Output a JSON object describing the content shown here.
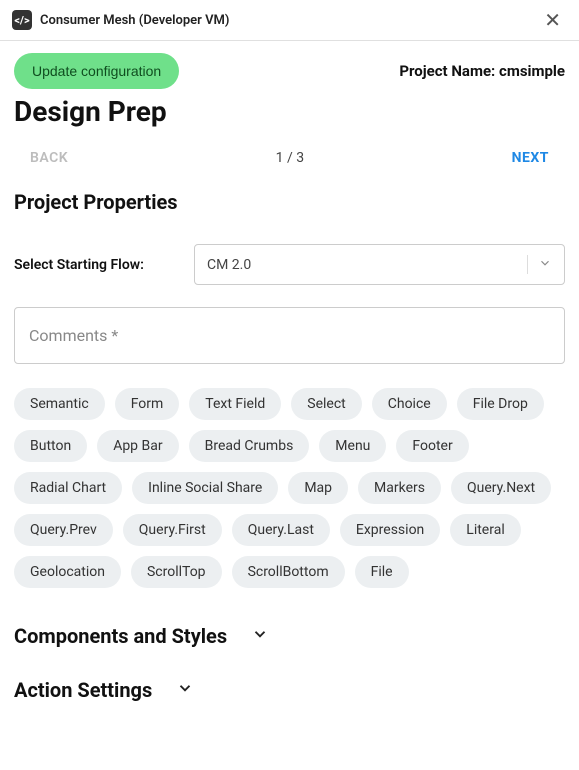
{
  "titlebar": {
    "title": "Consumer Mesh (Developer VM)"
  },
  "header": {
    "update_label": "Update configuration",
    "project_name_prefix": "Project Name: ",
    "project_name": "cmsimple"
  },
  "page_title": "Design Prep",
  "nav": {
    "back": "BACK",
    "counter": "1 / 3",
    "next": "NEXT"
  },
  "sections": {
    "project_properties": "Project Properties",
    "components_styles": "Components and Styles",
    "action_settings": "Action Settings"
  },
  "flow": {
    "label": "Select Starting Flow:",
    "value": "CM 2.0"
  },
  "comments": {
    "placeholder": "Comments *"
  },
  "chips": [
    "Semantic",
    "Form",
    "Text Field",
    "Select",
    "Choice",
    "File Drop",
    "Button",
    "App Bar",
    "Bread Crumbs",
    "Menu",
    "Footer",
    "Radial Chart",
    "Inline Social Share",
    "Map",
    "Markers",
    "Query.Next",
    "Query.Prev",
    "Query.First",
    "Query.Last",
    "Expression",
    "Literal",
    "Geolocation",
    "ScrollTop",
    "ScrollBottom",
    "File"
  ]
}
